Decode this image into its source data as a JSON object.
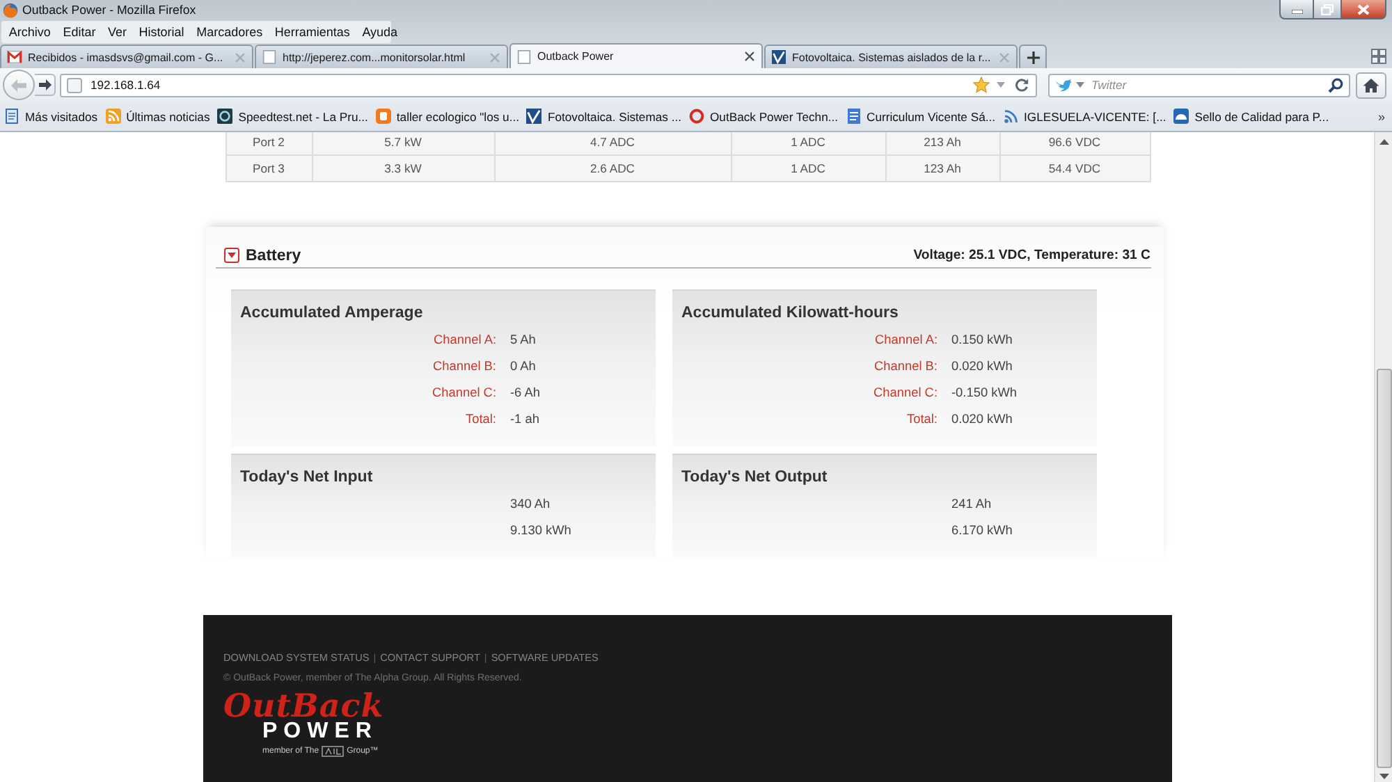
{
  "window": {
    "title": "Outback Power - Mozilla Firefox"
  },
  "menu": [
    "Archivo",
    "Editar",
    "Ver",
    "Historial",
    "Marcadores",
    "Herramientas",
    "Ayuda"
  ],
  "tabs": [
    {
      "title": "Recibidos - imasdsvs@gmail.com - G...",
      "kind": "mail",
      "selected": false
    },
    {
      "title": "http://jeperez.com...monitorsolar.html",
      "kind": "page",
      "selected": false
    },
    {
      "title": "Outback Power",
      "kind": "page",
      "selected": true
    },
    {
      "title": "Fotovoltaica. Sistemas aislados de la r...",
      "kind": "tile",
      "selected": false
    }
  ],
  "back_button": {
    "disabled": true
  },
  "address_bar": {
    "value": "192.168.1.64"
  },
  "search": {
    "placeholder": "Twitter"
  },
  "bookmarks": {
    "items": [
      {
        "label": "Más visitados",
        "kind": "page"
      },
      {
        "label": "Últimas noticias",
        "kind": "rss"
      },
      {
        "label": "Speedtest.net - La Pru...",
        "kind": "gauge"
      },
      {
        "label": "taller ecologico \"los u...",
        "kind": "blog"
      },
      {
        "label": "Fotovoltaica. Sistemas ...",
        "kind": "tile"
      },
      {
        "label": "OutBack Power Techn...",
        "kind": "ring"
      },
      {
        "label": "Curriculum Vicente Sá...",
        "kind": "doc"
      },
      {
        "label": "IGLESUELA-VICENTE: [...",
        "kind": "feed"
      },
      {
        "label": "Sello de Calidad para P...",
        "kind": "badge"
      }
    ],
    "overflow": "»"
  },
  "table": {
    "rows": [
      [
        "Port 2",
        "5.7 kW",
        "4.7 ADC",
        "1 ADC",
        "213 Ah",
        "96.6 VDC"
      ],
      [
        "Port 3",
        "3.3 kW",
        "2.6 ADC",
        "1 ADC",
        "123 Ah",
        "54.4 VDC"
      ]
    ]
  },
  "battery": {
    "title": "Battery",
    "expanded": true,
    "summary": "Voltage: 25.1 VDC, Temperature: 31 C",
    "cards": [
      {
        "title": "Accumulated Amperage",
        "rows": [
          {
            "label": "Channel A:",
            "value": "5 Ah"
          },
          {
            "label": "Channel B:",
            "value": "0 Ah"
          },
          {
            "label": "Channel C:",
            "value": "-6 Ah"
          },
          {
            "label": "Total:",
            "value": "-1 ah"
          }
        ]
      },
      {
        "title": "Accumulated Kilowatt-hours",
        "rows": [
          {
            "label": "Channel A:",
            "value": "0.150 kWh"
          },
          {
            "label": "Channel B:",
            "value": "0.020 kWh"
          },
          {
            "label": "Channel C:",
            "value": "-0.150 kWh"
          },
          {
            "label": "Total:",
            "value": "0.020 kWh"
          }
        ]
      },
      {
        "title": "Today's Net Input",
        "rows": [
          {
            "value": "340 Ah"
          },
          {
            "value": "9.130 kWh"
          }
        ]
      },
      {
        "title": "Today's Net Output",
        "rows": [
          {
            "value": "241 Ah"
          },
          {
            "value": "6.170 kWh"
          }
        ]
      }
    ]
  },
  "footer": {
    "nav": [
      {
        "kind": "link",
        "text": "DOWNLOAD SYSTEM STATUS"
      },
      {
        "kind": "separator",
        "text": "|"
      },
      {
        "kind": "link",
        "text": "CONTACT SUPPORT"
      },
      {
        "kind": "separator",
        "text": "|"
      },
      {
        "kind": "link",
        "text": "SOFTWARE UPDATES"
      }
    ],
    "copyright": "© OutBack Power, member of The Alpha Group. All Rights Reserved.",
    "logo": {
      "wordmark": "OutBack",
      "subtitle": "POWER",
      "tagline": "member of The",
      "tagline_end": "Group™"
    }
  }
}
